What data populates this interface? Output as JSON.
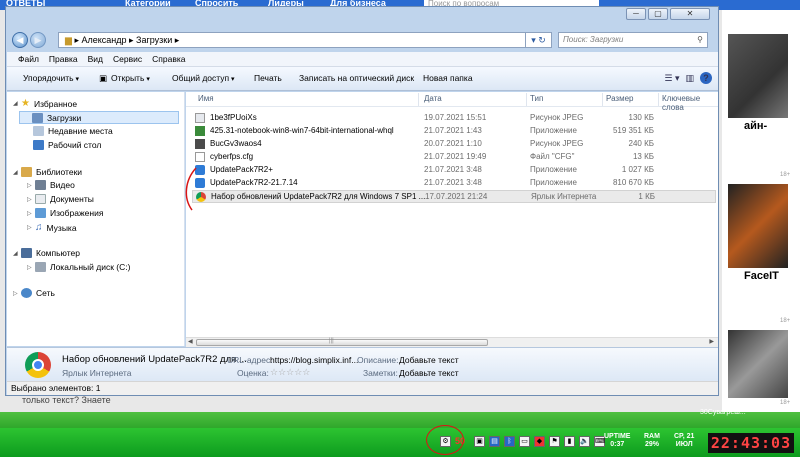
{
  "background": {
    "top_left_text": "ОТВЕТЫ",
    "top_links": [
      "Категории",
      "Спросить",
      "Лидеры",
      "Для бизнеса"
    ],
    "search_placeholder": "Поиск по вопросам",
    "right_headlines": [
      "айн-",
      "FaceIT"
    ],
    "right_small": [
      "18+",
      "18+",
      "18+"
    ],
    "left_snippet": "только текст? Знаете",
    "news_snippet": "30Сувагреш..."
  },
  "window": {
    "address": {
      "breadcrumb_part1": "Александр",
      "breadcrumb_part2": "Загрузки",
      "search_placeholder": "Поиск: Загрузки"
    },
    "menu": [
      "Файл",
      "Правка",
      "Вид",
      "Сервис",
      "Справка"
    ],
    "toolbar": {
      "organize": "Упорядочить",
      "open": "Открыть",
      "share": "Общий доступ",
      "print": "Печать",
      "burn": "Записать на оптический диск",
      "new_folder": "Новая папка"
    },
    "nav": {
      "favorites": "Избранное",
      "downloads": "Загрузки",
      "recent": "Недавние места",
      "desktop": "Рабочий стол",
      "libraries": "Библиотеки",
      "video": "Видео",
      "documents": "Документы",
      "images": "Изображения",
      "music": "Музыка",
      "computer": "Компьютер",
      "local_disk": "Локальный диск (C:)",
      "network": "Сеть"
    },
    "columns": {
      "name": "Имя",
      "date": "Дата",
      "type": "Тип",
      "size": "Размер",
      "keywords": "Ключевые слова"
    },
    "files": [
      {
        "name": "1be3fPUoiXs",
        "date": "19.07.2021 15:51",
        "type": "Рисунок JPEG",
        "size": "130 КБ"
      },
      {
        "name": "425.31-notebook-win8-win7-64bit-international-whql",
        "date": "21.07.2021 1:43",
        "type": "Приложение",
        "size": "519 351 КБ"
      },
      {
        "name": "BucGv3waos4",
        "date": "20.07.2021 1:10",
        "type": "Рисунок JPEG",
        "size": "240 КБ"
      },
      {
        "name": "cyberfps.cfg",
        "date": "21.07.2021 19:49",
        "type": "Файл \"CFG\"",
        "size": "13 КБ"
      },
      {
        "name": "UpdatePack7R2+",
        "date": "21.07.2021 3:48",
        "type": "Приложение",
        "size": "1 027 КБ"
      },
      {
        "name": "UpdatePack7R2-21.7.14",
        "date": "21.07.2021 3:48",
        "type": "Приложение",
        "size": "810 670 КБ"
      },
      {
        "name": "Набор обновлений UpdatePack7R2 для Windows 7 SP1 ...",
        "date": "17.07.2021 21:24",
        "type": "Ярлык Интернета",
        "size": "1 КБ"
      }
    ],
    "details": {
      "title": "Набор обновлений UpdatePack7R2 для ...",
      "subtitle": "Ярлык Интернета",
      "url_label": "URL-адрес:",
      "url_value": "https://blog.simplix.inf...",
      "rating_label": "Оценка:",
      "stars": "☆☆☆☆☆",
      "desc_label": "Описание:",
      "desc_value": "Добавьте текст",
      "notes_label": "Заметки:",
      "notes_value": "Добавьте текст"
    },
    "status": "Выбрано элементов: 1"
  },
  "taskbar": {
    "tray_badge": "50",
    "uptime_label": "UPTIME",
    "uptime_value": "0:37",
    "ram_label": "RAM",
    "ram_value": "29%",
    "date_line1": "СР, 21",
    "date_line2": "ИЮЛ",
    "clock": "22:43:03"
  }
}
